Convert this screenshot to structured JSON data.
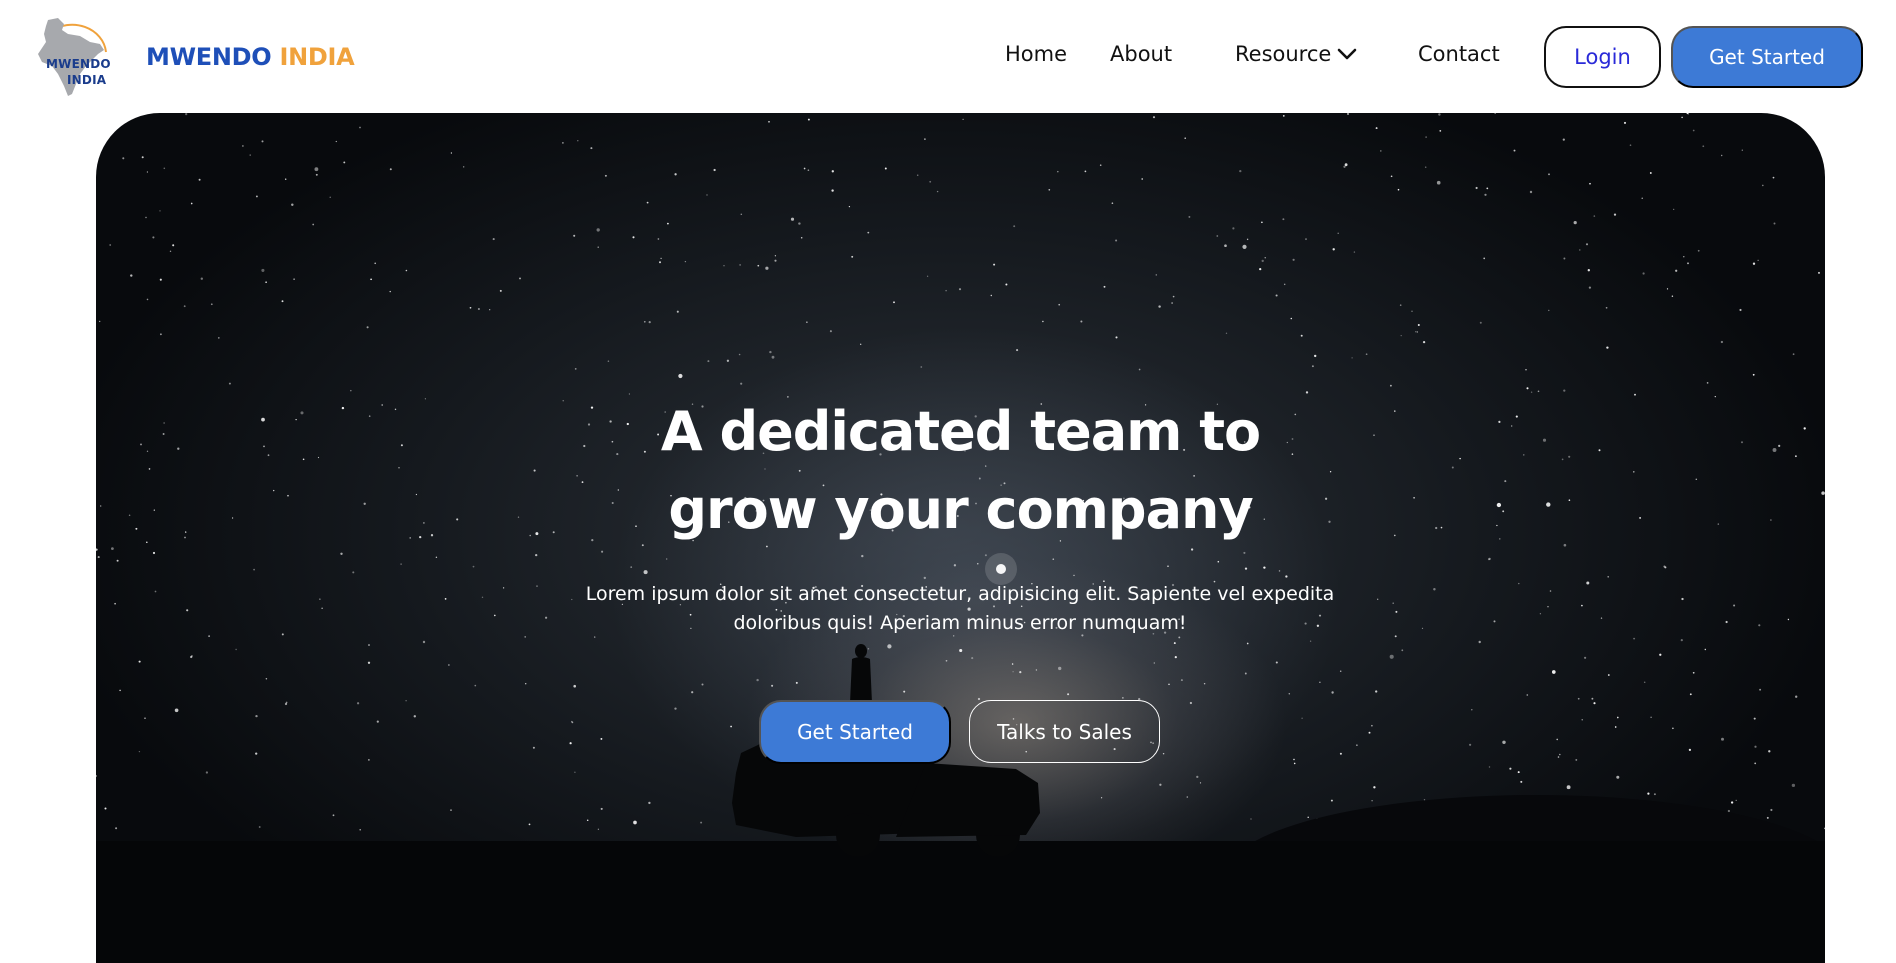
{
  "brand": {
    "logo_line1": "MWENDO",
    "logo_line2": "INDIA",
    "name_part1": "MWENDO",
    "name_part2": "INDIA",
    "primary_color": "#1e4fb8",
    "accent_color": "#f0a23c"
  },
  "nav": {
    "home": "Home",
    "about": "About",
    "resource": "Resource",
    "resource_icon": "chevron-down-icon",
    "contact": "Contact",
    "login": "Login",
    "get_started": "Get Started",
    "button_color": "#3d7ad6"
  },
  "hero": {
    "title_line1": "A dedicated team to",
    "title_line2": "grow your company",
    "subtitle": "Lorem ipsum dolor sit amet consectetur, adipisicing elit. Sapiente vel expedita doloribus quis! Aperiam minus error numquam!",
    "primary_button": "Get Started",
    "secondary_button": "Talks to Sales"
  }
}
